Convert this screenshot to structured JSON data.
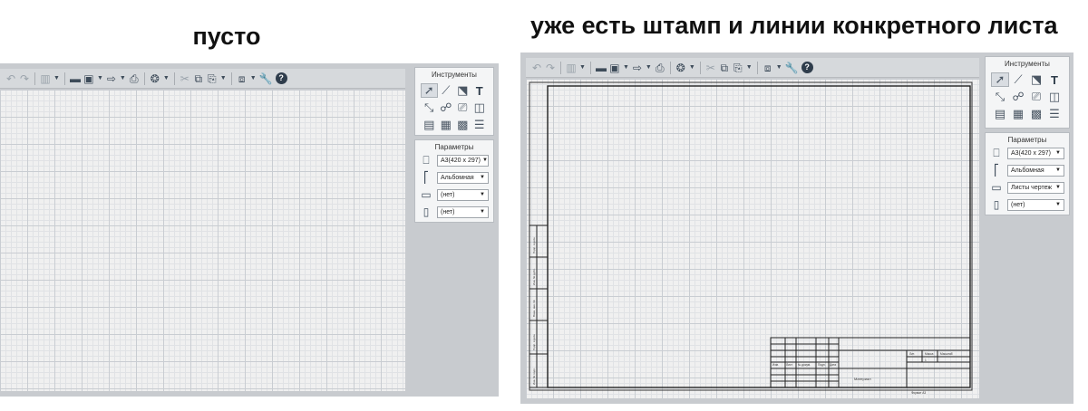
{
  "captions": {
    "left": "пусто",
    "right": "уже есть штамп и линии конкретного листа"
  },
  "toolbar": {
    "items": [
      {
        "icon": "undo-icon",
        "glyph": "↶",
        "kind": "faint"
      },
      {
        "icon": "redo-icon",
        "glyph": "↷",
        "kind": "faint"
      },
      {
        "kind": "sep"
      },
      {
        "icon": "layers-icon",
        "glyph": "▥",
        "kind": "faint"
      },
      {
        "icon": "chevron-down-icon",
        "glyph": "▼",
        "kind": "arrow"
      },
      {
        "kind": "sep"
      },
      {
        "icon": "open-folder-icon",
        "glyph": "▬"
      },
      {
        "icon": "save-icon",
        "glyph": "▣"
      },
      {
        "icon": "chevron-down-icon",
        "glyph": "▼",
        "kind": "arrow"
      },
      {
        "icon": "export-icon",
        "glyph": "⇨"
      },
      {
        "icon": "chevron-down-icon",
        "glyph": "▼",
        "kind": "arrow"
      },
      {
        "icon": "print-icon",
        "glyph": "⎙"
      },
      {
        "kind": "sep"
      },
      {
        "icon": "view-3d-icon",
        "glyph": "❂"
      },
      {
        "icon": "chevron-down-icon",
        "glyph": "▼",
        "kind": "arrow"
      },
      {
        "kind": "sep"
      },
      {
        "icon": "cut-icon",
        "glyph": "✂",
        "kind": "faint"
      },
      {
        "icon": "copy-icon",
        "glyph": "⧉"
      },
      {
        "icon": "paste-icon",
        "glyph": "⎘"
      },
      {
        "icon": "chevron-down-icon",
        "glyph": "▼",
        "kind": "arrow"
      },
      {
        "kind": "sep"
      },
      {
        "icon": "group-icon",
        "glyph": "⧈"
      },
      {
        "icon": "chevron-down-icon",
        "glyph": "▼",
        "kind": "arrow"
      },
      {
        "icon": "wrench-icon",
        "glyph": "🔧"
      },
      {
        "icon": "help-icon",
        "glyph": "?",
        "kind": "help"
      }
    ]
  },
  "tools_panel": {
    "title": "Инструменты",
    "tools": [
      {
        "icon": "pointer-icon",
        "glyph": "➚",
        "selected": true
      },
      {
        "icon": "line-icon",
        "glyph": "⟋"
      },
      {
        "icon": "shape-icon",
        "glyph": "⬔"
      },
      {
        "icon": "text-icon",
        "glyph": "T",
        "bold": true
      },
      {
        "icon": "dimension-icon",
        "glyph": "⤡"
      },
      {
        "icon": "node-icon",
        "glyph": "☍"
      },
      {
        "icon": "component-icon",
        "glyph": "⎚"
      },
      {
        "icon": "box-3d-icon",
        "glyph": "◫"
      },
      {
        "icon": "cabinet-icon",
        "glyph": "▤"
      },
      {
        "icon": "table-icon",
        "glyph": "▦"
      },
      {
        "icon": "grid-table-icon",
        "glyph": "▩"
      },
      {
        "icon": "list-icon",
        "glyph": "☰"
      }
    ]
  },
  "left_params": {
    "title": "Параметры",
    "rows": [
      {
        "icon": "sheet-size-icon",
        "glyph": "⎕",
        "value": "А3(420 x 297)"
      },
      {
        "icon": "orientation-icon",
        "glyph": "⎡",
        "value": "Альбомная"
      },
      {
        "icon": "frame-icon",
        "glyph": "▭",
        "value": "(нет)"
      },
      {
        "icon": "book-icon",
        "glyph": "▯",
        "value": "(нет)"
      }
    ]
  },
  "right_params": {
    "title": "Параметры",
    "rows": [
      {
        "icon": "sheet-size-icon",
        "glyph": "⎕",
        "value": "А3(420 x 297)"
      },
      {
        "icon": "orientation-icon",
        "glyph": "⎡",
        "value": "Альбомная"
      },
      {
        "icon": "frame-icon",
        "glyph": "▭",
        "value": "Листы чертеж"
      },
      {
        "icon": "book-icon",
        "glyph": "▯",
        "value": "(нет)"
      }
    ]
  },
  "stamp": {
    "sheet_label": "Лист",
    "sheets_label": "Листов",
    "mass_label": "Масса",
    "scale_label": "Масштаб",
    "lit_label": "Лит.",
    "sheet_value": "1",
    "changes_row": [
      "Изм.",
      "Лист",
      "№ докум.",
      "Подп.",
      "Дата"
    ],
    "material": "Материал",
    "copy_label": "Копировал",
    "format_label": "Формат A3"
  },
  "frame_side": {
    "labels": [
      "Инв. № подл.",
      "Подп. и дата",
      "Взам. инв. №",
      "Инв. № дубл.",
      "Подп. и дата"
    ]
  }
}
